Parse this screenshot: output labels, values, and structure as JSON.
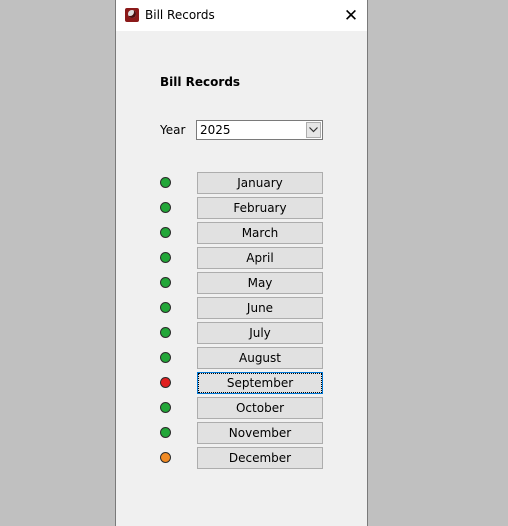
{
  "window": {
    "title": "Bill Records",
    "close_glyph": "✕"
  },
  "form": {
    "heading": "Bill Records",
    "year_label": "Year",
    "year_value": "2025"
  },
  "status_colors": {
    "paid": "#22a638",
    "overdue": "#e01f1f",
    "pending": "#f08a24"
  },
  "months": [
    {
      "label": "January",
      "status": "paid"
    },
    {
      "label": "February",
      "status": "paid"
    },
    {
      "label": "March",
      "status": "paid"
    },
    {
      "label": "April",
      "status": "paid"
    },
    {
      "label": "May",
      "status": "paid"
    },
    {
      "label": "June",
      "status": "paid"
    },
    {
      "label": "July",
      "status": "paid"
    },
    {
      "label": "August",
      "status": "paid"
    },
    {
      "label": "September",
      "status": "overdue",
      "focused": true
    },
    {
      "label": "October",
      "status": "paid"
    },
    {
      "label": "November",
      "status": "paid"
    },
    {
      "label": "December",
      "status": "pending"
    }
  ]
}
